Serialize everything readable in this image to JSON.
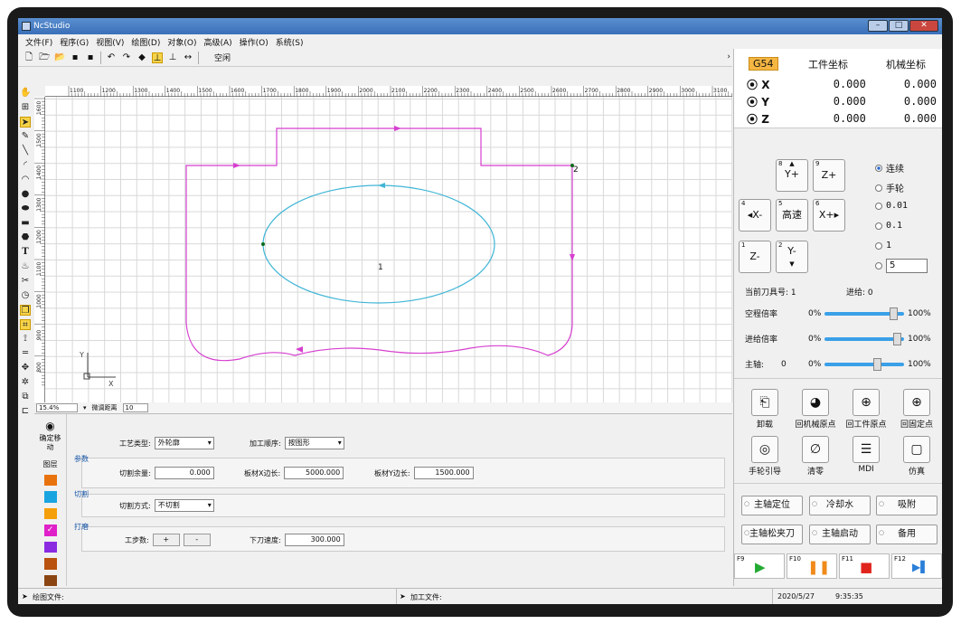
{
  "window": {
    "title": "NcStudio",
    "minimize": "–",
    "maximize": "□",
    "close": "✕"
  },
  "menu": [
    "文件(F)",
    "程序(G)",
    "视图(V)",
    "绘图(D)",
    "对象(O)",
    "高级(A)",
    "操作(O)",
    "系统(S)"
  ],
  "toolbar": {
    "status": "空闲",
    "icons": [
      "new-file-icon",
      "open-icon",
      "folder-icon",
      "save-icon",
      "save-as-icon",
      "undo-icon",
      "redo-icon",
      "eraser-icon",
      "align-icon",
      "distribute-icon",
      "mirror-icon"
    ],
    "collapse": "›"
  },
  "left_tools": [
    "hand-icon",
    "zoom-window-icon",
    "select-arrow-icon",
    "pen-icon",
    "line-icon",
    "arc-icon",
    "arc2-icon",
    "circle-icon",
    "ellipse-icon",
    "rectangle-icon",
    "polygon-icon",
    "text-icon",
    "bucket-icon",
    "trim-icon",
    "clock-icon",
    "layer-icon",
    "crop-icon",
    "node-icon",
    "measure-icon",
    "move-icon",
    "explode-icon",
    "array-icon",
    "group-icon"
  ],
  "ruler": {
    "top_labels": [
      "1100",
      "1200",
      "1300",
      "1400",
      "1500",
      "1600",
      "1700",
      "1800",
      "1900",
      "2000",
      "2100",
      "2200",
      "2300",
      "2400",
      "2500",
      "2600",
      "2700",
      "2800",
      "2900",
      "3000",
      "3100"
    ],
    "left_labels": [
      "1600",
      "1500",
      "1400",
      "1300",
      "1200",
      "1100",
      "1000",
      "900",
      "800"
    ]
  },
  "canvas": {
    "label_outer": "2",
    "label_inner": "1",
    "axis_x": "X",
    "axis_y": "Y"
  },
  "zoom": {
    "value": "15.4%",
    "nudge_label": "微调距离",
    "nudge_value": "10"
  },
  "bottom": {
    "icon_label": "确定移动",
    "layer_label": "图层",
    "swatches": [
      "#e8730e",
      "#1aa5e0",
      "#f5a00a",
      "#e020c8",
      "#8a2be2",
      "#b8520e",
      "#8b4513"
    ],
    "process_type_label": "工艺类型:",
    "process_type_value": "外轮廓",
    "order_label": "加工顺序:",
    "order_value": "按图形",
    "param_group": "参数",
    "cut_margin_label": "切割余量:",
    "cut_margin_value": "0.000",
    "board_x_label": "板材X边长:",
    "board_x_value": "5000.000",
    "board_y_label": "板材Y边长:",
    "board_y_value": "1500.000",
    "cut_group": "切割",
    "cut_mode_label": "切割方式:",
    "cut_mode_value": "不切割",
    "punch_group": "打磨",
    "steps_label": "工步数:",
    "plus": "+",
    "minus": "-",
    "down_speed_label": "下刀速度:",
    "down_speed_value": "300.000",
    "expand": "▾"
  },
  "coords": {
    "system": "G54",
    "col_work": "工件坐标",
    "col_machine": "机械坐标",
    "rows": [
      {
        "axis": "X",
        "work": "0.000",
        "machine": "0.000"
      },
      {
        "axis": "Y",
        "work": "0.000",
        "machine": "0.000"
      },
      {
        "axis": "Z",
        "work": "0.000",
        "machine": "0.000"
      }
    ]
  },
  "jog": {
    "y_plus": {
      "n": "8",
      "label": "Y+",
      "arrow": "▲"
    },
    "z_plus": {
      "n": "9",
      "label": "Z+"
    },
    "x_minus": {
      "n": "4",
      "label": "◂X-"
    },
    "fast": {
      "n": "5",
      "label": "高速"
    },
    "x_plus": {
      "n": "6",
      "label": "X+▸"
    },
    "z_minus": {
      "n": "1",
      "label": "Z-"
    },
    "y_minus": {
      "n": "2",
      "label": "Y-",
      "arrow": "▼"
    }
  },
  "modes": [
    {
      "label": "连续",
      "selected": true
    },
    {
      "label": "手轮",
      "selected": false
    },
    {
      "label": "0.01",
      "selected": false
    },
    {
      "label": "0.1",
      "selected": false
    },
    {
      "label": "1",
      "selected": false
    },
    {
      "label": "5",
      "selected": false
    }
  ],
  "tool_info": {
    "tool_label": "当前刀具号: 1",
    "feed_label": "进给: 0"
  },
  "sliders": [
    {
      "label": "空程倍率",
      "min": "0%",
      "max": "100%",
      "level": 0.85
    },
    {
      "label": "进给倍率",
      "min": "0%",
      "max": "100%",
      "level": 0.9
    },
    {
      "label": "主轴:",
      "extra": "0",
      "min": "0%",
      "max": "100%",
      "level": 0.66
    }
  ],
  "icon_buttons": [
    {
      "label": "卸载",
      "icon": "unload-icon",
      "glyph": "⎗"
    },
    {
      "label": "回机械原点",
      "icon": "machine-origin-icon",
      "glyph": "◕"
    },
    {
      "label": "回工件原点",
      "icon": "work-origin-icon",
      "glyph": "⊕"
    },
    {
      "label": "回固定点",
      "icon": "fixed-point-icon",
      "glyph": "⊕"
    },
    {
      "label": "手轮引导",
      "icon": "handwheel-icon",
      "glyph": "◎"
    },
    {
      "label": "清零",
      "icon": "zero-icon",
      "glyph": "∅"
    },
    {
      "label": "MDI",
      "icon": "mdi-icon",
      "glyph": "☰"
    },
    {
      "label": "仿真",
      "icon": "simulate-icon",
      "glyph": "▢"
    }
  ],
  "spindle_buttons": [
    "主轴定位",
    "冷却水",
    "吸附",
    "主轴松夹刀",
    "主轴启动",
    "备用"
  ],
  "run_buttons": [
    {
      "key": "F9",
      "glyph": "▶",
      "color": "#22aa33"
    },
    {
      "key": "F10",
      "glyph": "❚❚",
      "color": "#f08a1a"
    },
    {
      "key": "F11",
      "glyph": "■",
      "color": "#e0241c"
    },
    {
      "key": "F12",
      "glyph": "▶▌",
      "color": "#2a7fd8"
    }
  ],
  "statusbar": {
    "draw_file": "绘图文件:",
    "process_file": "加工文件:",
    "date": "2020/5/27",
    "time": "9:35:35",
    "arrow": "➤"
  }
}
